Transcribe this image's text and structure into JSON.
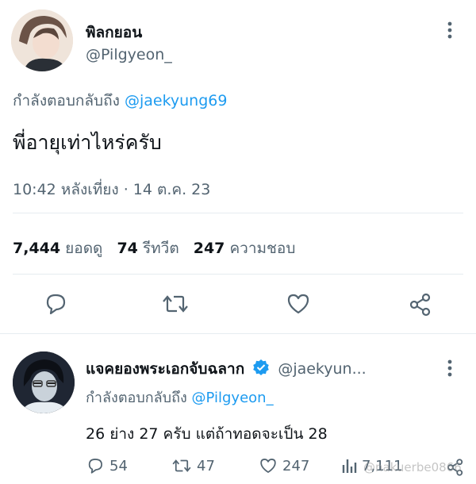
{
  "tweet": {
    "display_name": "พิลกยอน",
    "handle": "@Pilgyeon_",
    "reply_prefix": "กำลังตอบกลับถึง",
    "reply_to": "@jaekyung69",
    "text": "พี่อายุเท่าไหร่ครับ",
    "timestamp": "10:42 หลังเที่ยง · 14 ต.ค. 23",
    "views_count": "7,444",
    "views_label": "ยอดดู",
    "retweets_count": "74",
    "retweets_label": "รีทวีต",
    "likes_count": "247",
    "likes_label": "ความชอบ"
  },
  "reply": {
    "display_name": "แจคยองพระเอกจับฉลาก",
    "handle": "@jaekyun...",
    "reply_prefix": "กำลังตอบกลับถึง",
    "reply_to": "@Pilgyeon_",
    "text": "26 ย่าง 27 ครับ แต่ถ้าทอดจะเป็น 28",
    "comments": "54",
    "retweets": "47",
    "likes": "247",
    "views": "7,111"
  },
  "watermark": "@nakuerbe0866",
  "colors": {
    "accent": "#1d9bf0",
    "text": "#0f1419",
    "muted": "#536471",
    "verified": "#1d9bf0"
  },
  "icons": [
    "more-icon",
    "comment-icon",
    "retweet-icon",
    "like-icon",
    "share-icon",
    "verified-icon",
    "views-icon"
  ]
}
